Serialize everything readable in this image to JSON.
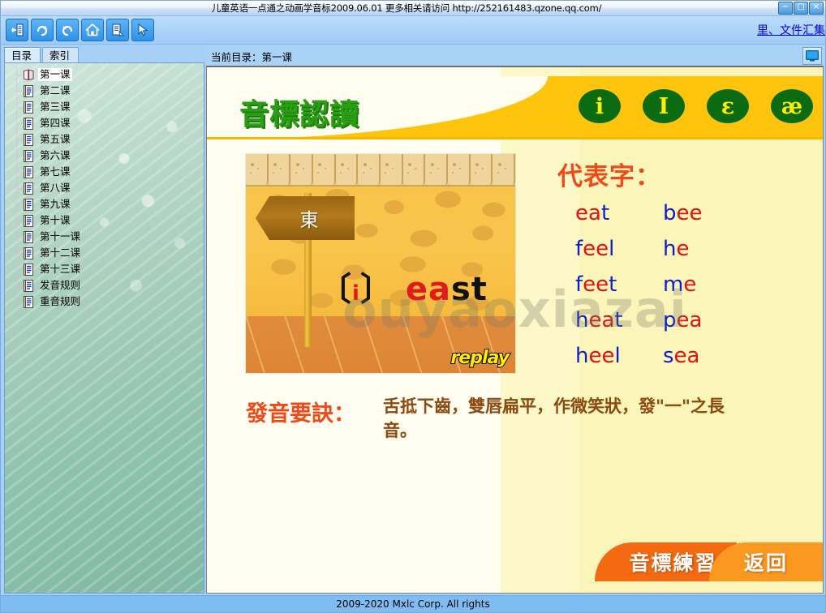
{
  "window": {
    "title": "儿童英语一点通之动画学音标2009.06.01 更多相关请访问 http://252161483.qzone.qq.com/",
    "minimize_label": "−",
    "maximize_label": "□",
    "close_label": "×"
  },
  "toolbar": {
    "buttons": [
      {
        "name": "hide-pane-icon",
        "label": "隐藏"
      },
      {
        "name": "forward-icon",
        "label": "前进"
      },
      {
        "name": "back-icon",
        "label": "后退"
      },
      {
        "name": "home-icon",
        "label": "主页"
      },
      {
        "name": "print-icon",
        "label": "打印"
      },
      {
        "name": "select-cursor-icon",
        "label": "选择"
      }
    ],
    "link_text": "里、文件汇集"
  },
  "sidebar": {
    "tabs": [
      {
        "label": "目录",
        "active": true
      },
      {
        "label": "索引",
        "active": false
      }
    ],
    "tree": [
      {
        "label": "第一课",
        "selected": true,
        "icon": "open-book-icon"
      },
      {
        "label": "第二课",
        "selected": false,
        "icon": "document-icon"
      },
      {
        "label": "第三课",
        "selected": false,
        "icon": "document-icon"
      },
      {
        "label": "第四课",
        "selected": false,
        "icon": "document-icon"
      },
      {
        "label": "第五课",
        "selected": false,
        "icon": "document-icon"
      },
      {
        "label": "第六课",
        "selected": false,
        "icon": "document-icon"
      },
      {
        "label": "第七课",
        "selected": false,
        "icon": "document-icon"
      },
      {
        "label": "第八课",
        "selected": false,
        "icon": "document-icon"
      },
      {
        "label": "第九课",
        "selected": false,
        "icon": "document-icon"
      },
      {
        "label": "第十课",
        "selected": false,
        "icon": "document-icon"
      },
      {
        "label": "第十一课",
        "selected": false,
        "icon": "document-icon"
      },
      {
        "label": "第十二课",
        "selected": false,
        "icon": "document-icon"
      },
      {
        "label": "第十三课",
        "selected": false,
        "icon": "document-icon"
      },
      {
        "label": "发音规则",
        "selected": false,
        "icon": "document-icon"
      },
      {
        "label": "重音规则",
        "selected": false,
        "icon": "document-icon"
      }
    ]
  },
  "content": {
    "header": "当前目录：第一课",
    "fullscreen_icon": "monitor-icon",
    "banner": {
      "title": "音標認讀",
      "title_color": "#2a9e14",
      "background_color": "#ffc40c",
      "ipa_buttons": [
        {
          "symbol": "i",
          "name": "ipa-i"
        },
        {
          "symbol": "I",
          "name": "ipa-capital-i"
        },
        {
          "symbol": "ɛ",
          "name": "ipa-epsilon"
        },
        {
          "symbol": "æ",
          "name": "ipa-ae"
        }
      ]
    },
    "illustration": {
      "sign_text": "東",
      "word_bracket_open": "〔",
      "word_bracket_close": "〕",
      "ipa_symbol": "i",
      "word_prefix": "",
      "word_vowel": "ea",
      "word_suffix": "st",
      "replay_label": "replay"
    },
    "words_section": {
      "title": "代表字：",
      "vowel_color": "#e31010",
      "consonant_color": "#0a1fc8",
      "rows": [
        {
          "left": [
            {
              "t": "ea",
              "c": "v"
            },
            {
              "t": "t",
              "c": "c"
            }
          ],
          "right": [
            {
              "t": "b",
              "c": "c"
            },
            {
              "t": "ee",
              "c": "v"
            }
          ]
        },
        {
          "left": [
            {
              "t": "f",
              "c": "c"
            },
            {
              "t": "ee",
              "c": "v"
            },
            {
              "t": "l",
              "c": "c"
            }
          ],
          "right": [
            {
              "t": "h",
              "c": "c"
            },
            {
              "t": "e",
              "c": "v"
            }
          ]
        },
        {
          "left": [
            {
              "t": "f",
              "c": "c"
            },
            {
              "t": "ee",
              "c": "v"
            },
            {
              "t": "t",
              "c": "c"
            }
          ],
          "right": [
            {
              "t": "m",
              "c": "c"
            },
            {
              "t": "e",
              "c": "v"
            }
          ]
        },
        {
          "left": [
            {
              "t": "h",
              "c": "c"
            },
            {
              "t": "ea",
              "c": "v"
            },
            {
              "t": "t",
              "c": "c"
            }
          ],
          "right": [
            {
              "t": "p",
              "c": "c"
            },
            {
              "t": "ea",
              "c": "v"
            }
          ]
        },
        {
          "left": [
            {
              "t": "h",
              "c": "c"
            },
            {
              "t": "ee",
              "c": "v"
            },
            {
              "t": "l",
              "c": "c"
            }
          ],
          "right": [
            {
              "t": "s",
              "c": "c"
            },
            {
              "t": "ea",
              "c": "v"
            }
          ]
        }
      ]
    },
    "tip": {
      "label": "發音要訣：",
      "text": "舌抵下齒，雙唇扁平，作微笑狀，發\"一\"之長音。"
    },
    "bottom_buttons": [
      {
        "label": "音標練習",
        "name": "practice-button",
        "color": "#f36a10"
      },
      {
        "label": "返回",
        "name": "back-button",
        "color": "#fb9820"
      }
    ],
    "watermark": "ouyaoxiazai"
  },
  "statusbar": {
    "text": "2009-2020 Mxlc Corp. All rights"
  }
}
